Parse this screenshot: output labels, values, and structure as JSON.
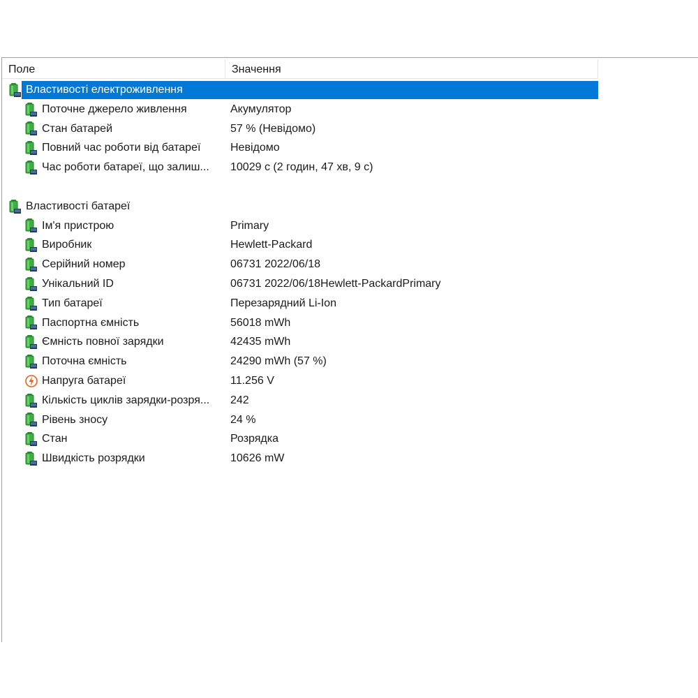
{
  "columns": {
    "field": "Поле",
    "value": "Значення"
  },
  "groups": [
    {
      "title": "Властивості електроживлення",
      "selected": true,
      "icon": "battery-icon",
      "items": [
        {
          "field": "Поточне джерело живлення",
          "value": "Акумулятор",
          "icon": "battery-icon"
        },
        {
          "field": "Стан батарей",
          "value": "57 % (Невідомо)",
          "icon": "battery-icon"
        },
        {
          "field": "Повний час роботи від батареї",
          "value": "Невідомо",
          "icon": "battery-icon"
        },
        {
          "field": "Час роботи батареї, що залиш...",
          "value": "10029 с (2 годин, 47 хв, 9 с)",
          "icon": "battery-icon"
        }
      ]
    },
    {
      "title": "Властивості батареї",
      "selected": false,
      "icon": "battery-icon",
      "items": [
        {
          "field": "Ім'я пристрою",
          "value": "Primary",
          "icon": "battery-icon"
        },
        {
          "field": "Виробник",
          "value": "Hewlett-Packard",
          "icon": "battery-icon"
        },
        {
          "field": "Серійний номер",
          "value": "06731 2022/06/18",
          "icon": "battery-icon"
        },
        {
          "field": "Унікальний ID",
          "value": "06731 2022/06/18Hewlett-PackardPrimary",
          "icon": "battery-icon"
        },
        {
          "field": "Тип батареї",
          "value": "Перезарядний Li-Ion",
          "icon": "battery-icon"
        },
        {
          "field": "Паспортна ємність",
          "value": "56018 mWh",
          "icon": "battery-icon"
        },
        {
          "field": "Ємність повної зарядки",
          "value": "42435 mWh",
          "icon": "battery-icon"
        },
        {
          "field": "Поточна ємність",
          "value": "24290 mWh  (57 %)",
          "icon": "battery-icon"
        },
        {
          "field": "Напруга батареї",
          "value": "11.256 V",
          "icon": "voltage-icon"
        },
        {
          "field": "Кількість циклів зарядки-розря...",
          "value": "242",
          "icon": "battery-icon"
        },
        {
          "field": "Рівень зносу",
          "value": "24 %",
          "icon": "battery-icon"
        },
        {
          "field": "Стан",
          "value": "Розрядка",
          "icon": "battery-icon"
        },
        {
          "field": "Швидкість розрядки",
          "value": "10626 mW",
          "icon": "battery-icon"
        }
      ]
    }
  ],
  "colors": {
    "selection": "#0078d7",
    "battery_green": "#3cb043",
    "voltage_orange": "#e8601c"
  }
}
